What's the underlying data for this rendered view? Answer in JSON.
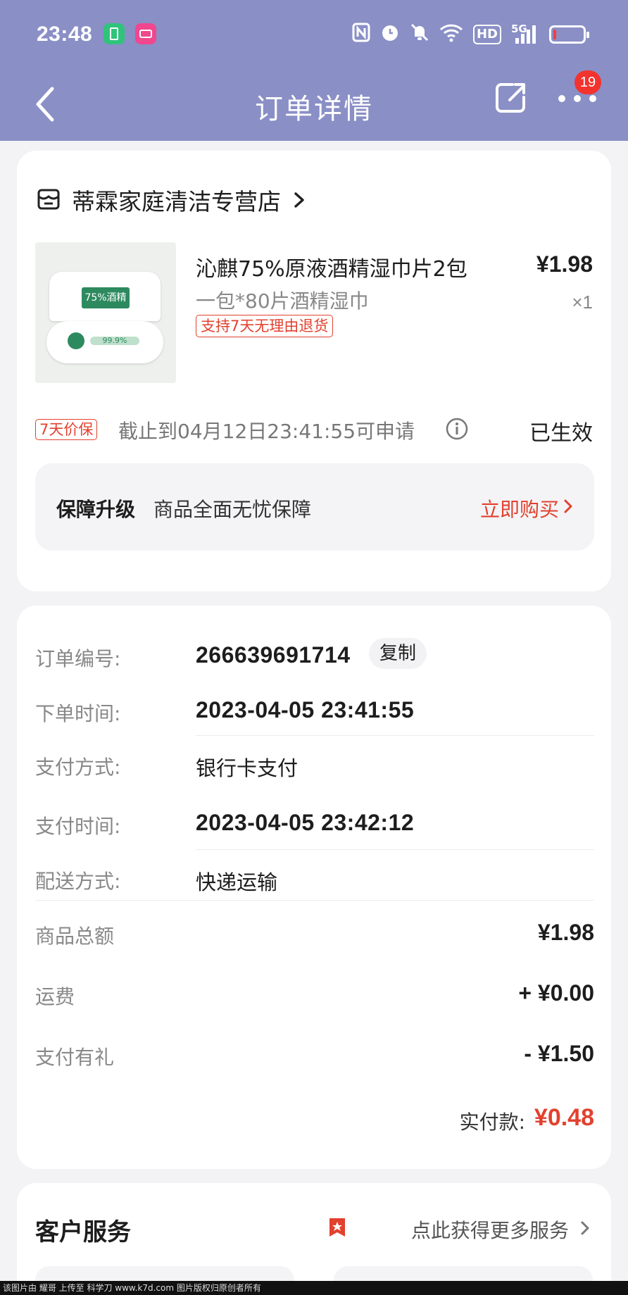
{
  "status_bar": {
    "time": "23:48",
    "network": "5G",
    "hd": "HD",
    "icons": [
      "nfc-icon",
      "alarm-icon",
      "mute-icon",
      "wifi-icon",
      "signal-icon",
      "battery-icon"
    ],
    "battery_level": 0.1
  },
  "nav": {
    "title": "订单详情",
    "badge_count": "19"
  },
  "shop": {
    "name": "蒂霖家庭清洁专营店"
  },
  "product": {
    "name": "沁麒75%原液酒精湿巾片2包",
    "spec": "一包*80片酒精湿巾",
    "return_tag": "支持7天无理由退货",
    "price": "¥1.98",
    "qty": "×1",
    "package_text": "75%酒精",
    "package_percent": "99.9%"
  },
  "price_protect": {
    "tag": "7天价保",
    "deadline": "截止到04月12日23:41:55可申请",
    "status": "已生效"
  },
  "upgrade": {
    "title": "保障升级",
    "desc": "商品全面无忧保障",
    "buy_label": "立即购买"
  },
  "order": {
    "number_label": "订单编号:",
    "number": "266639691714",
    "copy_label": "复制",
    "time_label": "下单时间:",
    "time": "2023-04-05 23:41:55",
    "pay_method_label": "支付方式:",
    "pay_method": "银行卡支付",
    "pay_time_label": "支付时间:",
    "pay_time": "2023-04-05 23:42:12",
    "delivery_label": "配送方式:",
    "delivery": "快递运输"
  },
  "amounts": {
    "goods_total_label": "商品总额",
    "goods_total": "¥1.98",
    "shipping_label": "运费",
    "shipping": "+ ¥0.00",
    "pay_gift_label": "支付有礼",
    "pay_gift": "- ¥1.50",
    "paid_label": "实付款:",
    "paid": "¥0.48"
  },
  "customer_service": {
    "title": "客户服务",
    "link": "点此获得更多服务"
  },
  "watermark": "该图片由 耀哥 上传至 科学刀 www.k7d.com 图片版权归原创者所有",
  "colors": {
    "header_bg": "#8a8fc6",
    "accent_red": "#e2412e",
    "page_bg": "#f3f3f5"
  }
}
